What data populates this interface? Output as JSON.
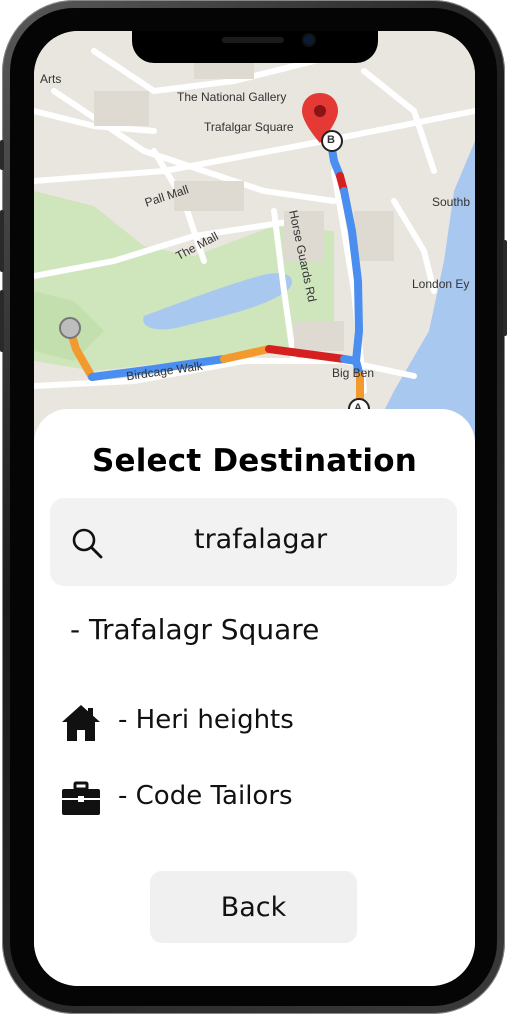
{
  "map": {
    "labels": {
      "arts": "Arts",
      "national_gallery": "The National Gallery",
      "trafalgar_square": "Trafalgar Square",
      "pall_mall": "Pall Mall",
      "the_mall": "The Mall",
      "horse_guards": "Horse Guards Rd",
      "birdcage_walk": "Birdcage Walk",
      "big_ben": "Big Ben",
      "southbank": "Southb",
      "london_eye": "London Ey",
      "marker_b": "B",
      "marker_a": "A"
    },
    "colors": {
      "route_blue": "#4a8ef0",
      "route_orange": "#f29a2e",
      "route_red": "#d61f1f",
      "water": "#a8c8f0",
      "park": "#c7e3b4",
      "pin": "#e53935"
    }
  },
  "sheet": {
    "title": "Select Destination",
    "search": {
      "value": "trafalagar",
      "icon": "search-icon"
    },
    "result": "- Trafalagr Square",
    "favorites": [
      {
        "icon": "home-icon",
        "label": "- Heri heights"
      },
      {
        "icon": "briefcase-icon",
        "label": "- Code Tailors"
      }
    ],
    "back_label": "Back"
  }
}
